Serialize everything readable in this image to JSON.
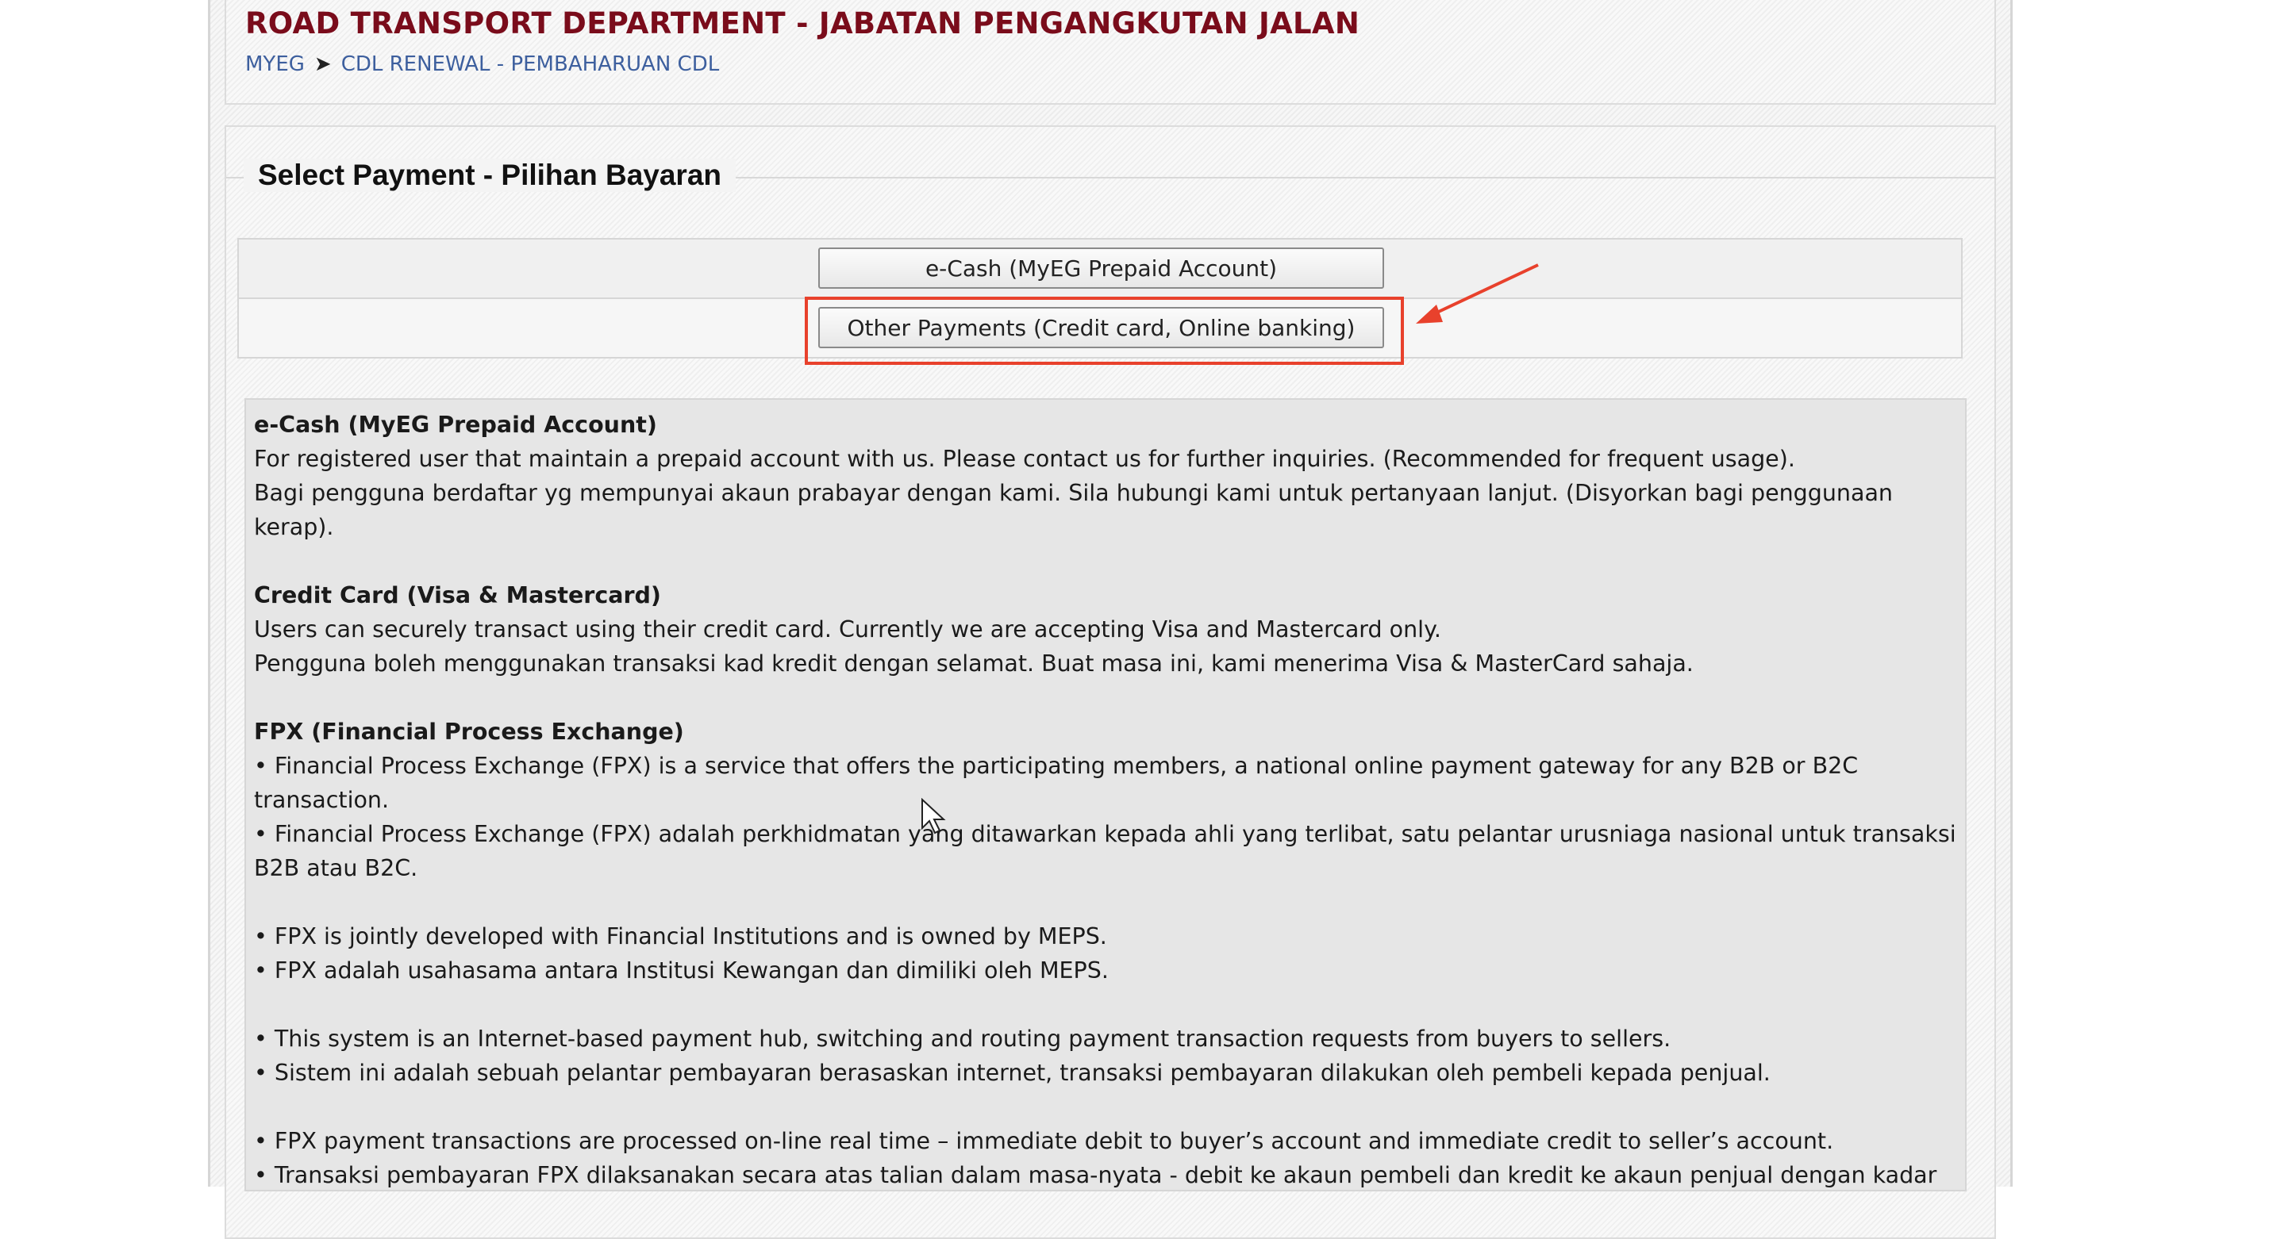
{
  "header": {
    "title": "ROAD TRANSPORT DEPARTMENT - JABATAN PENGANGKUTAN JALAN",
    "breadcrumb": [
      {
        "label": "MYEG"
      },
      {
        "label": "CDL RENEWAL - PEMBAHARUAN CDL"
      }
    ]
  },
  "section": {
    "title": "Select Payment - Pilihan Bayaran",
    "buttons": [
      {
        "label": "e-Cash (MyEG Prepaid Account)"
      },
      {
        "label": "Other Payments (Credit card, Online banking)"
      }
    ]
  },
  "info": {
    "ecash": {
      "title": "e-Cash (MyEG Prepaid Account)",
      "en": "For registered user that maintain a prepaid account with us. Please contact us for further inquiries. (Recommended for frequent usage).",
      "ms": "Bagi pengguna berdaftar yg mempunyai akaun prabayar dengan kami. Sila hubungi kami untuk pertanyaan lanjut. (Disyorkan bagi penggunaan kerap)."
    },
    "card": {
      "title": "Credit Card (Visa & Mastercard)",
      "en": "Users can securely transact using their credit card. Currently we are accepting Visa and Mastercard only.",
      "ms": "Pengguna boleh menggunakan transaksi kad kredit dengan selamat. Buat masa ini, kami menerima Visa & MasterCard sahaja."
    },
    "fpx": {
      "title": "FPX (Financial Process Exchange)",
      "p1": "• Financial Process Exchange (FPX) is a service that offers the participating members, a national online payment gateway for any B2B or B2C transaction.",
      "p2": "• Financial Process Exchange (FPX) adalah perkhidmatan yang ditawarkan kepada ahli yang terlibat, satu pelantar urusniaga nasional untuk transaksi B2B atau B2C.",
      "p3": "• FPX is jointly developed with Financial Institutions and is owned by MEPS.",
      "p4": "• FPX adalah usahasama antara Institusi Kewangan dan dimiliki oleh MEPS.",
      "p5": "• This system is an Internet-based payment hub, switching and routing payment transaction requests from buyers to sellers.",
      "p6": "• Sistem ini adalah sebuah pelantar pembayaran berasaskan internet, transaksi pembayaran dilakukan oleh pembeli kepada penjual.",
      "p7": "• FPX payment transactions are processed on-line real time – immediate debit to buyer’s account and immediate credit to seller’s account.",
      "p8": "• Transaksi pembayaran FPX dilaksanakan secara atas talian dalam masa-nyata - debit ke akaun pembeli dan kredit ke akaun penjual dengan kadar"
    }
  },
  "colors": {
    "title": "#7a0c1b",
    "link": "#3d5f9e",
    "highlight": "#e8412c"
  }
}
